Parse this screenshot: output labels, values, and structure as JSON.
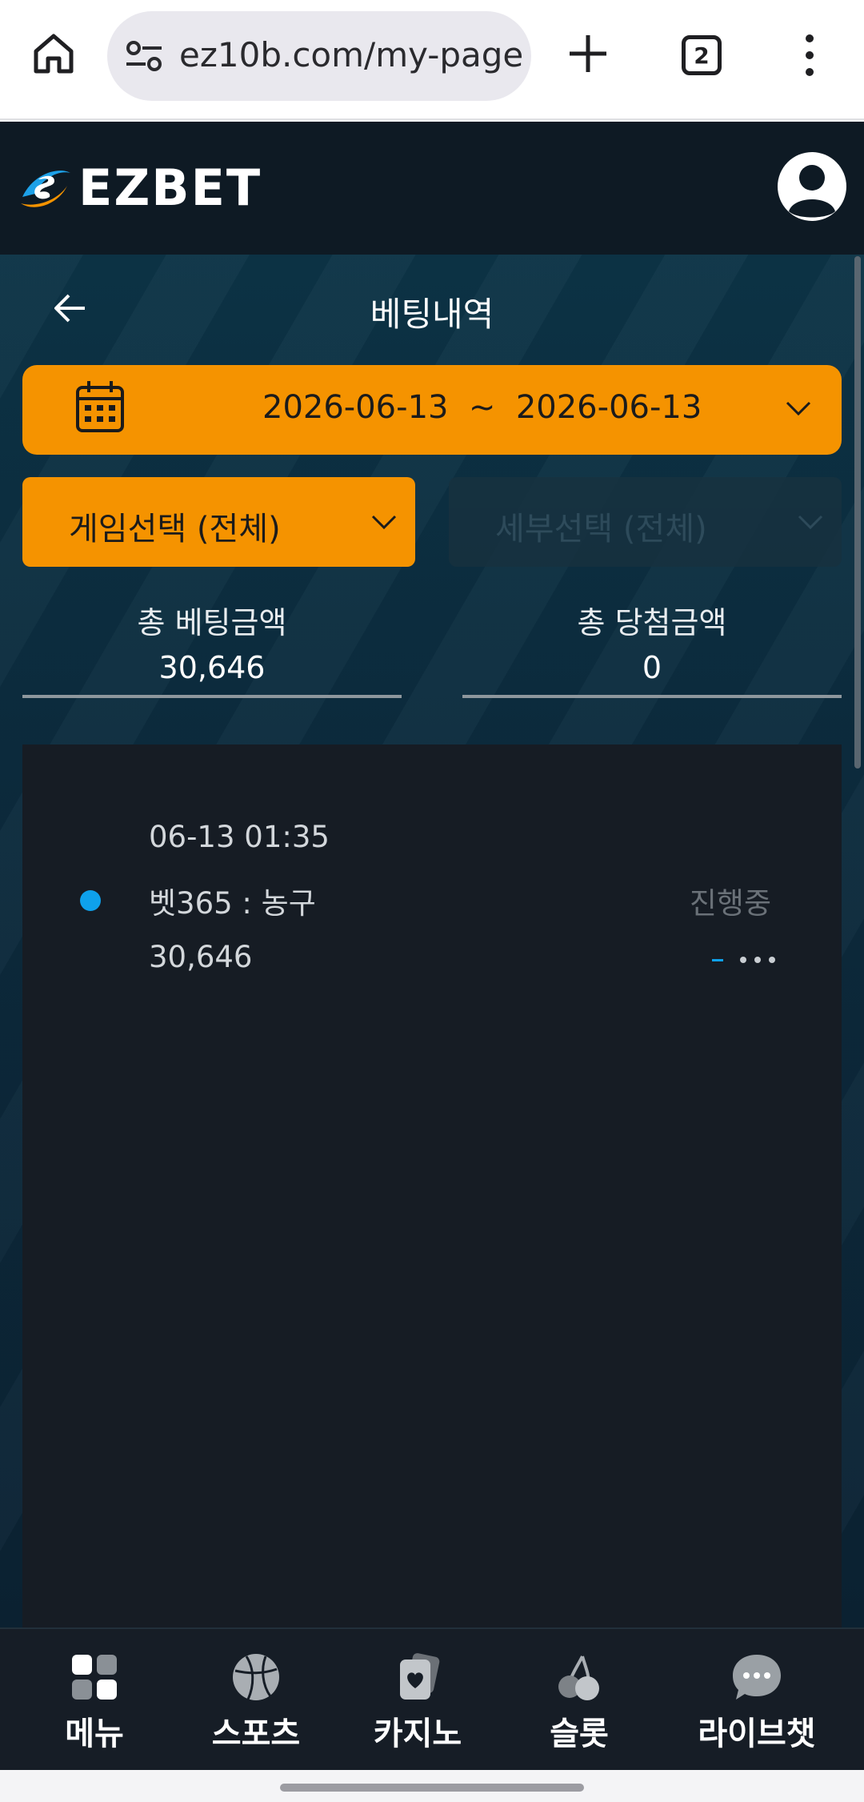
{
  "browser": {
    "url": "ez10b.com/my-page",
    "tab_count": "2"
  },
  "header": {
    "logo_text": "EZBET"
  },
  "page": {
    "title": "베팅내역"
  },
  "filters": {
    "date_range": "2026-06-13  ~  2026-06-13",
    "game_select": "게임선택 (전체)",
    "detail_select": "세부선택 (전체)"
  },
  "summary": {
    "total_bet_label": "총 베팅금액",
    "total_bet_value": "30,646",
    "total_win_label": "총 당첨금액",
    "total_win_value": "0"
  },
  "bets": [
    {
      "datetime": "06-13 01:35",
      "game": "벳365 : 농구",
      "amount": "30,646",
      "status": "진행중"
    }
  ],
  "bottom_nav": {
    "items": [
      {
        "label": "메뉴",
        "icon": "menu-grid-icon"
      },
      {
        "label": "스포츠",
        "icon": "basketball-icon"
      },
      {
        "label": "카지노",
        "icon": "casino-cards-icon"
      },
      {
        "label": "슬롯",
        "icon": "cherry-icon"
      },
      {
        "label": "라이브챗",
        "icon": "chat-bubble-icon"
      }
    ]
  },
  "colors": {
    "accent_orange": "#f59300",
    "status_dot": "#0ea1ec",
    "header_bg": "#0e1a24",
    "panel_bg": "#161c24"
  }
}
